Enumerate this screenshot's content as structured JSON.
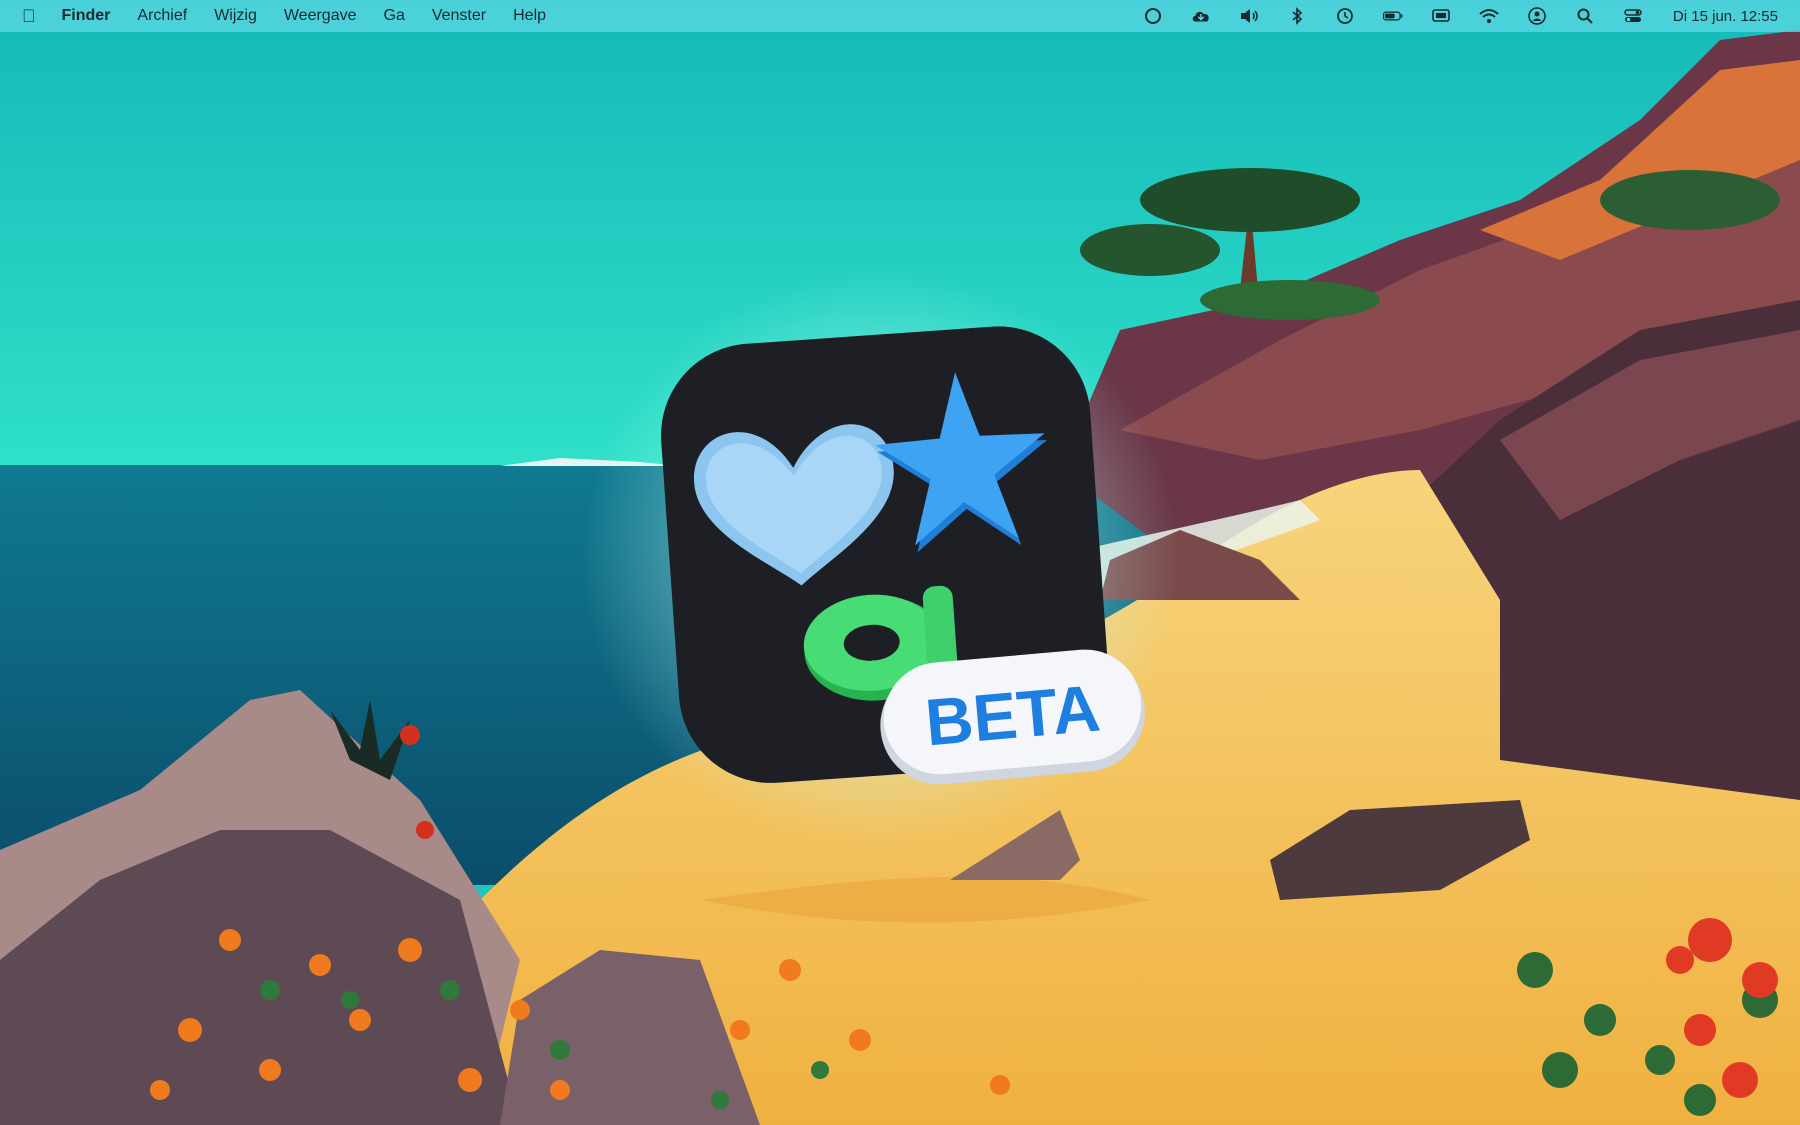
{
  "menubar": {
    "app_name": "Finder",
    "menus": [
      "Archief",
      "Wijzig",
      "Weergave",
      "Ga",
      "Venster",
      "Help"
    ],
    "status_icons": [
      "focus-icon",
      "icloud-icon",
      "volume-icon",
      "bluetooth-icon",
      "time-machine-icon",
      "battery-icon",
      "display-icon",
      "wifi-icon",
      "user-icon",
      "search-icon",
      "control-center-icon"
    ],
    "clock": "Di 15 jun.  12:55"
  },
  "app_icon": {
    "badge_label": "BETA",
    "glyph_letter": "a"
  },
  "colors": {
    "sky": "#1fc8c4",
    "sea": "#0f6f86",
    "sand": "#f6c45a",
    "cliff": "#5b3a4a",
    "icon_bg": "#1d1f24",
    "heart": "#9fd2f5",
    "star": "#2f98f0",
    "glyph": "#3dd66a",
    "badge_text": "#1f7fe0"
  }
}
